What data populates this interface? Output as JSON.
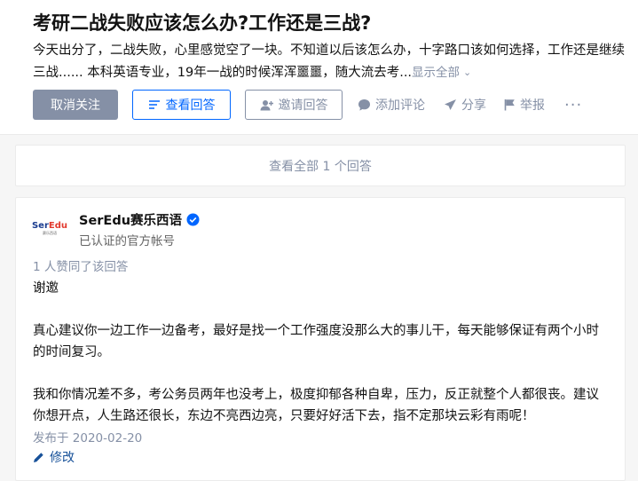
{
  "question": {
    "title": "考研二战失败应该怎么办?工作还是三战?",
    "detail": "今天出分了，二战失败，心里感觉空了一块。不知道以后该怎么办，十字路口该如何选择，工作还是继续三战...... 本科英语专业，19年一战的时候浑浑噩噩，随大流去考...",
    "show_all": "显示全部",
    "buttons": {
      "unfollow": "取消关注",
      "view_answers": "查看回答",
      "invite": "邀请回答"
    },
    "actions": {
      "comment": "添加评论",
      "share": "分享",
      "report": "举报",
      "more": "···"
    }
  },
  "view_all_answers": "查看全部 1 个回答",
  "answer": {
    "author": {
      "name": "SerEdu赛乐西语",
      "headline": "已认证的官方帐号",
      "avatar_logo_a": "Ser",
      "avatar_logo_b": "Edu",
      "avatar_sub": "赛乐西语"
    },
    "vote_info": "1 人赞同了该回答",
    "paragraphs": [
      "谢邀",
      "真心建议你一边工作一边备考，最好是找一个工作强度没那么大的事儿干，每天能够保证有两个小时的时间复习。",
      "我和你情况差不多，考公务员两年也没考上，极度抑郁各种自卑，压力，反正就整个人都很丧。建议你想开点，人生路还很长，东边不亮西边亮，只要好好活下去，指不定那块云彩有雨呢！"
    ],
    "posted": "发布于 2020-02-20",
    "edit": "修改"
  },
  "colors": {
    "brand_blue": "#0066ff",
    "gray": "#8590a6",
    "verified": "#0066ff",
    "link": "#175199"
  }
}
